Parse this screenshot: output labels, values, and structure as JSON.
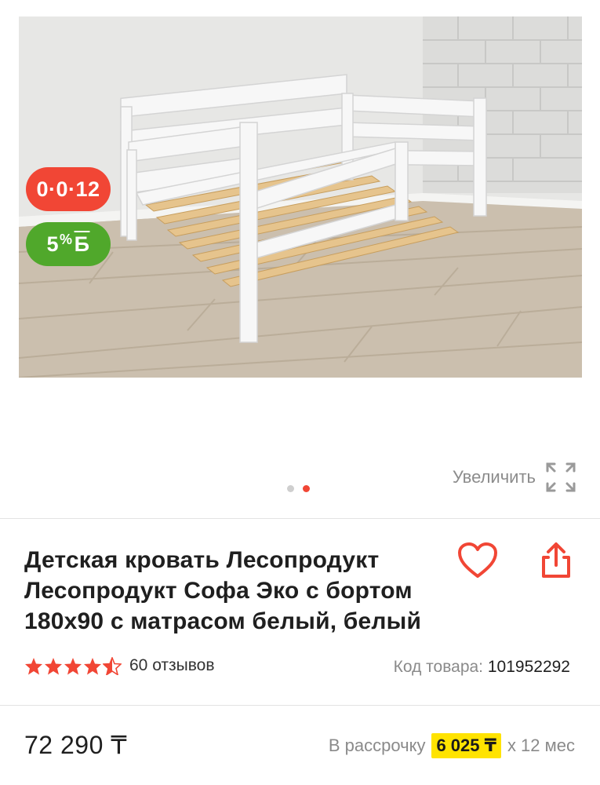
{
  "gallery": {
    "image_alt": "Детская кровать Софа Эко с бортом",
    "badge_installment": "0·0·12",
    "badge_bonus_number": "5",
    "badge_bonus_percent": "%",
    "badge_bonus_symbol": "Б",
    "dots": {
      "count": 2,
      "active_index": 1
    },
    "zoom_label": "Увеличить",
    "colors": {
      "installment_badge": "#f14635",
      "bonus_badge": "#50a82b",
      "active_dot": "#f14635"
    }
  },
  "product": {
    "title": "Детская кровать Лесопродукт Лесопродукт Софа Эко с бортом 180x90 с матрасом белый, белый",
    "favorite_icon": "heart-icon",
    "share_icon": "share-icon",
    "rating": {
      "value": 4.5,
      "max": 5
    },
    "reviews_label": "60 отзывов",
    "sku_label": "Код товара:",
    "sku_value": "101952292"
  },
  "price": {
    "amount": "72 290 ₸",
    "installment_prefix": "В рассрочку",
    "installment_amount": "6 025 ₸",
    "installment_suffix": "х 12 мес",
    "colors": {
      "accent": "#f14635",
      "installment_highlight": "#ffe300"
    }
  }
}
